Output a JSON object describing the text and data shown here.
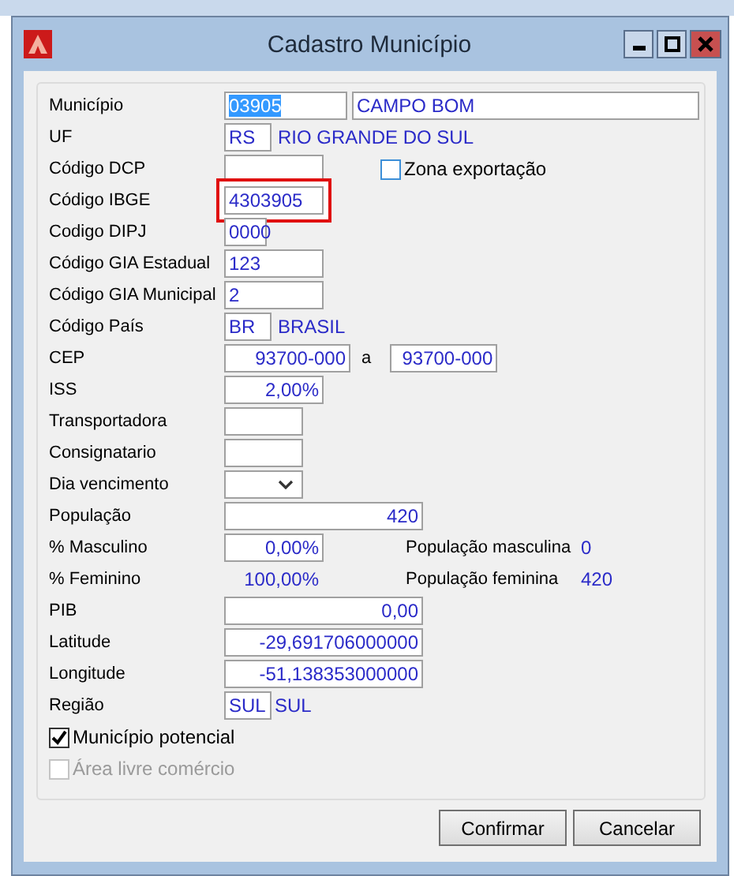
{
  "dialog": {
    "title": "Cadastro Município"
  },
  "rows": [
    {
      "label": "Município",
      "items": [
        {
          "kind": "field",
          "value": "03905",
          "text_selected": true,
          "highlighted": false
        },
        {
          "kind": "field",
          "value": "CAMPO BOM",
          "text_selected": false,
          "highlighted": false
        }
      ]
    },
    {
      "label": "UF",
      "items": [
        {
          "kind": "field",
          "value": "RS",
          "text_selected": false,
          "highlighted": false
        },
        {
          "kind": "text",
          "value": "RIO GRANDE DO SUL"
        }
      ]
    },
    {
      "label": "Código DCP",
      "items": [
        {
          "kind": "field",
          "highlighted": false
        },
        {
          "kind": "checkbox",
          "label": "Zona exportação",
          "checked": false,
          "disabled": false
        }
      ]
    },
    {
      "label": "Código IBGE",
      "items": [
        {
          "kind": "field",
          "value": "4303905",
          "text_selected": false,
          "highlighted": true
        }
      ]
    },
    {
      "label": "Codigo DIPJ",
      "items": [
        {
          "kind": "field",
          "value": "0000",
          "text_selected": false,
          "highlighted": false
        }
      ]
    },
    {
      "label": "Código GIA Estadual",
      "items": [
        {
          "kind": "field",
          "value": "123",
          "text_selected": false,
          "highlighted": false
        }
      ]
    },
    {
      "label": "Código GIA Municipal",
      "items": [
        {
          "kind": "field",
          "value": "2",
          "text_selected": false,
          "highlighted": false
        }
      ]
    },
    {
      "label": "Código País",
      "items": [
        {
          "kind": "field",
          "value": "BR",
          "text_selected": false,
          "highlighted": false
        },
        {
          "kind": "text",
          "value": "BRASIL"
        }
      ]
    },
    {
      "label": "CEP",
      "items": [
        {
          "kind": "field",
          "value": "93700-000",
          "text_selected": false,
          "highlighted": false
        },
        {
          "kind": "label",
          "value": "a"
        },
        {
          "kind": "field",
          "value": "93700-000",
          "text_selected": false,
          "highlighted": false
        }
      ]
    },
    {
      "label": "ISS",
      "items": [
        {
          "kind": "field",
          "value": "2,00%",
          "text_selected": false,
          "highlighted": false
        }
      ]
    },
    {
      "label": "Transportadora",
      "items": [
        {
          "kind": "field",
          "highlighted": false
        }
      ]
    },
    {
      "label": "Consignatario",
      "items": [
        {
          "kind": "field",
          "highlighted": false
        }
      ]
    },
    {
      "label": "Dia vencimento",
      "items": [
        {
          "kind": "dropdown"
        }
      ]
    },
    {
      "label": "População",
      "items": [
        {
          "kind": "field",
          "value": "420",
          "text_selected": false,
          "highlighted": false
        }
      ]
    },
    {
      "label": "% Masculino",
      "items": [
        {
          "kind": "field",
          "value": "0,00%",
          "text_selected": false,
          "highlighted": false
        },
        {
          "kind": "label",
          "value": "População masculina"
        },
        {
          "kind": "text",
          "value": "0"
        }
      ]
    },
    {
      "label": "% Feminino",
      "items": [
        {
          "kind": "text",
          "value": "100,00%"
        },
        {
          "kind": "label",
          "value": "População feminina"
        },
        {
          "kind": "text",
          "value": "420"
        }
      ]
    },
    {
      "label": "PIB",
      "items": [
        {
          "kind": "field",
          "value": "0,00",
          "text_selected": false,
          "highlighted": false
        }
      ]
    },
    {
      "label": "Latitude",
      "items": [
        {
          "kind": "field",
          "value": "-29,691706000000",
          "text_selected": false,
          "highlighted": false
        }
      ]
    },
    {
      "label": "Longitude",
      "items": [
        {
          "kind": "field",
          "value": "-51,138353000000",
          "text_selected": false,
          "highlighted": false
        }
      ]
    },
    {
      "label": "Região",
      "items": [
        {
          "kind": "field",
          "value": "SUL",
          "text_selected": false,
          "highlighted": false
        },
        {
          "kind": "text",
          "value": "SUL"
        }
      ]
    },
    {
      "items": [
        {
          "kind": "checkbox",
          "label": "Município potencial",
          "checked": true,
          "disabled": false
        }
      ]
    },
    {
      "items": [
        {
          "kind": "checkbox",
          "label": "Área livre comércio",
          "checked": false,
          "disabled": true
        }
      ]
    }
  ],
  "buttons": [
    {
      "label": "Confirmar"
    },
    {
      "label": "Cancelar"
    }
  ]
}
